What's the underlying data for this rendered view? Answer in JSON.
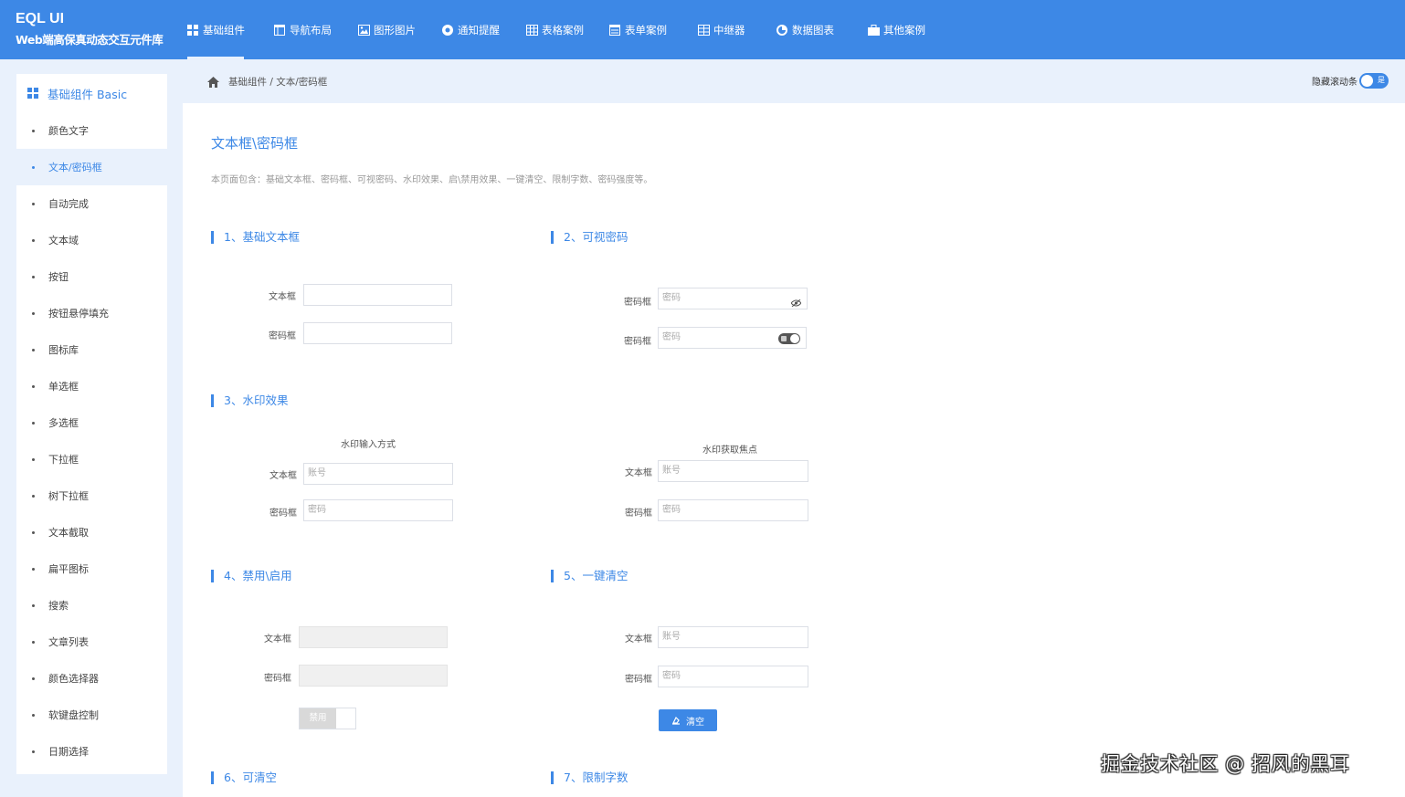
{
  "brand": {
    "title": "EQL UI",
    "subtitle": "Web端高保真动态交互元件库"
  },
  "nav": {
    "items": [
      {
        "label": "基础组件",
        "icon": "grid-icon"
      },
      {
        "label": "导航布局",
        "icon": "layout-icon"
      },
      {
        "label": "图形图片",
        "icon": "image-icon"
      },
      {
        "label": "通知提醒",
        "icon": "bell-icon"
      },
      {
        "label": "表格案例",
        "icon": "table-icon"
      },
      {
        "label": "表单案例",
        "icon": "form-icon"
      },
      {
        "label": "中继器",
        "icon": "repeater-icon"
      },
      {
        "label": "数据图表",
        "icon": "chart-icon"
      },
      {
        "label": "其他案例",
        "icon": "briefcase-icon"
      }
    ],
    "active_index": 0
  },
  "sidebar": {
    "header": "基础组件 Basic",
    "items": [
      "颜色文字",
      "文本/密码框",
      "自动完成",
      "文本域",
      "按钮",
      "按钮悬停填充",
      "图标库",
      "单选框",
      "多选框",
      "下拉框",
      "树下拉框",
      "文本截取",
      "扁平图标",
      "搜索",
      "文章列表",
      "颜色选择器",
      "软键盘控制",
      "日期选择"
    ],
    "active_index": 1
  },
  "breadcrumb": {
    "text": "基础组件 / 文本/密码框"
  },
  "scroll_toggle": {
    "label": "隐藏滚动条",
    "state_text": "是",
    "on": true
  },
  "page": {
    "title": "文本框\\密码框",
    "description": "本页面包含：基础文本框、密码框、可视密码、水印效果、启\\禁用效果、一键清空、限制字数、密码强度等。"
  },
  "sections": {
    "s1": {
      "title": "1、基础文本框",
      "text_label": "文本框",
      "pwd_label": "密码框"
    },
    "s2": {
      "title": "2、可视密码",
      "pwd_label1": "密码框",
      "pwd_label2": "密码框",
      "placeholder": "密码"
    },
    "s3": {
      "title": "3、水印效果",
      "left_caption": "水印输入方式",
      "right_caption": "水印获取焦点",
      "text_label": "文本框",
      "pwd_label": "密码框",
      "account_placeholder": "账号",
      "pwd_placeholder": "密码"
    },
    "s4": {
      "title": "4、禁用\\启用",
      "text_label": "文本框",
      "pwd_label": "密码框",
      "button_label": "禁用"
    },
    "s5": {
      "title": "5、一键清空",
      "text_label": "文本框",
      "pwd_label": "密码框",
      "account_placeholder": "账号",
      "pwd_placeholder": "密码",
      "button_label": "清空"
    },
    "s6": {
      "title": "6、可清空"
    },
    "s7": {
      "title": "7、限制字数"
    }
  },
  "watermark": "掘金技术社区 @ 招风的黑耳",
  "colors": {
    "primary": "#3d88e6",
    "sidebar_bg": "#e9f1fc"
  }
}
